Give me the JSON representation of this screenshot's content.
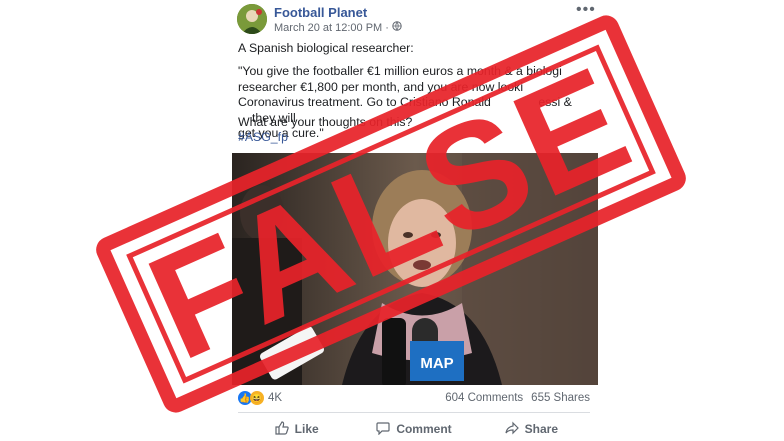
{
  "post": {
    "page_name": "Football Planet",
    "date": "March 20 at 12:00 PM",
    "separator": "·",
    "more_icon": "more-horizontal-icon",
    "intro": "A Spanish biological researcher:",
    "quote_line1": "\"You give the footballer €1 million euros a month & a biologi",
    "quote_line2": "researcher €1,800 per month, and you are now looki",
    "quote_line3": "Coronavirus treatment. Go to Cristiano Ronald",
    "quote_line3b": "essi &",
    "quote_line3c": "they will",
    "quote_line4": "get you a cure.\"",
    "question": "What are your thoughts on this?",
    "hashtag": "#ASG_fp",
    "microphone_logo": "MAP"
  },
  "stats": {
    "reaction_count": "4K",
    "comments": "604 Comments",
    "shares": "655 Shares"
  },
  "actions": {
    "like": "Like",
    "comment": "Comment",
    "share": "Share"
  },
  "stamp": {
    "text": "FALSE",
    "color": "#e8232a"
  }
}
